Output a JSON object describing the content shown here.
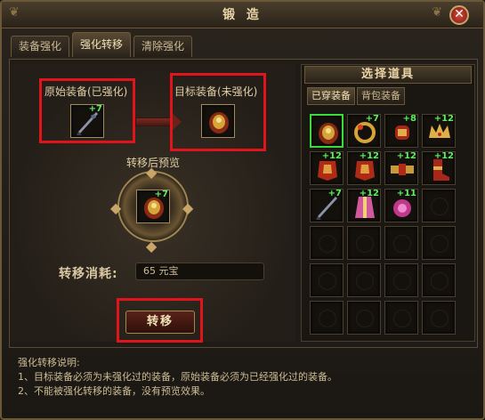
{
  "window": {
    "title": "锻 造",
    "close_label": "✕"
  },
  "tabs": [
    {
      "label": "装备强化"
    },
    {
      "label": "强化转移",
      "active": true
    },
    {
      "label": "清除强化"
    }
  ],
  "source": {
    "label": "原始装备(已强化)",
    "plus": "+7",
    "icon": "dark-blade-icon"
  },
  "target": {
    "label": "目标装备(未强化)",
    "icon": "dragon-armor-icon"
  },
  "preview": {
    "label": "转移后预览",
    "plus": "+7",
    "icon": "dragon-armor-icon"
  },
  "cost": {
    "label": "转移消耗:",
    "value": "65 元宝"
  },
  "transfer_button": "转移",
  "item_panel": {
    "title": "选择道具",
    "tabs": [
      {
        "label": "已穿装备",
        "active": true
      },
      {
        "label": "背包装备"
      }
    ],
    "items": [
      {
        "icon": "dragon-armor-icon",
        "plus": "",
        "selected": true
      },
      {
        "icon": "gold-ring-icon",
        "plus": "+7"
      },
      {
        "icon": "red-bracer-icon",
        "plus": "+8"
      },
      {
        "icon": "gold-crown-icon",
        "plus": "+12"
      },
      {
        "icon": "red-armor-icon",
        "plus": "+12"
      },
      {
        "icon": "red-armor-icon",
        "plus": "+12"
      },
      {
        "icon": "gold-belt-icon",
        "plus": "+12"
      },
      {
        "icon": "red-boots-icon",
        "plus": "+12"
      },
      {
        "icon": "dark-blade-icon",
        "plus": "+7"
      },
      {
        "icon": "pink-robe-icon",
        "plus": "+12"
      },
      {
        "icon": "pink-amulet-icon",
        "plus": "+11"
      },
      {
        "icon": "",
        "plus": ""
      },
      {
        "icon": "",
        "plus": ""
      },
      {
        "icon": "",
        "plus": ""
      },
      {
        "icon": "",
        "plus": ""
      },
      {
        "icon": "",
        "plus": ""
      },
      {
        "icon": "",
        "plus": ""
      },
      {
        "icon": "",
        "plus": ""
      },
      {
        "icon": "",
        "plus": ""
      },
      {
        "icon": "",
        "plus": ""
      },
      {
        "icon": "",
        "plus": ""
      },
      {
        "icon": "",
        "plus": ""
      },
      {
        "icon": "",
        "plus": ""
      },
      {
        "icon": "",
        "plus": ""
      }
    ]
  },
  "description": {
    "title": "强化转移说明:",
    "lines": [
      "1、目标装备必须为未强化过的装备，原始装备必须为已经强化过的装备。",
      "2、不能被强化转移的装备，没有预览效果。"
    ]
  }
}
